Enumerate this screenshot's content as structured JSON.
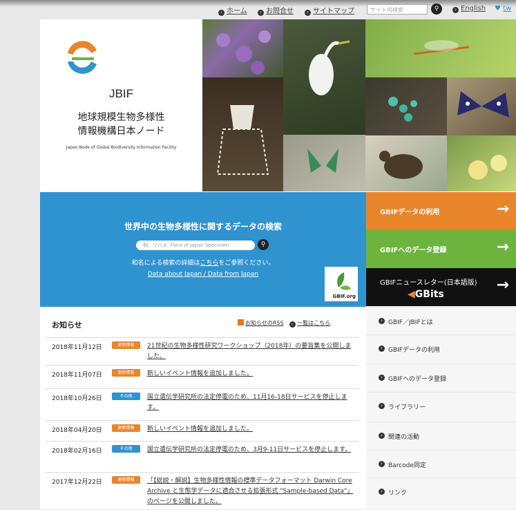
{
  "nav": {
    "home": "ホーム",
    "contact": "お問合せ",
    "sitemap": "サイトマップ",
    "search_placeholder": "サイト内検索",
    "english": "English",
    "twitter": "tw"
  },
  "logo": {
    "abbr": "JBIF",
    "name_line1": "地球規模生物多様性",
    "name_line2": "情報機構日本ノード",
    "english_name": "Japan Node of Global Biodiversity Information Facility"
  },
  "search_panel": {
    "title": "世界中の生物多様性に関するデータの検索",
    "placeholder": "例：ツバメ, Flora of Japan Specimen",
    "note_before": "和名による検索の詳細は",
    "note_link": "こちら",
    "note_after": "をご参照ください。",
    "data_link": "Data about Japan / Data from Japan",
    "gbif_logo_text": "GBIF.org"
  },
  "side_buttons": [
    {
      "label": "GBIFデータの利用",
      "color": "#e9852b"
    },
    {
      "label": "GBIFへのデータ登録",
      "color": "#6db43f"
    },
    {
      "label": "GBIFニュースレター(日本語版)",
      "sub": "GBits",
      "color": "#111111"
    }
  ],
  "news": {
    "heading": "お知らせ",
    "rss": "お知らせのRSS",
    "all": "一覧はこちら",
    "items": [
      {
        "date": "2018年11月12日",
        "badge": "更新情報",
        "badge_color": "#e9852b",
        "text": "21世紀の生物多様性研究ワークショップ（2018年）の要旨集を公開しました。"
      },
      {
        "date": "2018年11月07日",
        "badge": "更新情報",
        "badge_color": "#e9852b",
        "text": "新しいイベント情報を追加しました。"
      },
      {
        "date": "2018年10月26日",
        "badge": "その他",
        "badge_color": "#2f93cf",
        "text": "国立遺伝学研究所の法定停電のため、11月16-18日サービスを停止します。"
      },
      {
        "date": "2018年04月20日",
        "badge": "更新情報",
        "badge_color": "#e9852b",
        "text": "新しいイベント情報を追加しました。"
      },
      {
        "date": "2018年02月16日",
        "badge": "その他",
        "badge_color": "#2f93cf",
        "text": "国立遺伝学研究所の法定停電のため、3月9-11日サービスを停止します。"
      },
      {
        "date": "2017年12月22日",
        "badge": "更新情報",
        "badge_color": "#e9852b",
        "text": "「【総説・解説】生物多様性情報の標準データフォーマット Darwin Core Archive と生態学データに適合させる拡張形式 \"Sample-based Data\"」のページを公開しました。"
      }
    ]
  },
  "right_menu": [
    {
      "label": "GBIF／JBIFとは"
    },
    {
      "label": "GBIFデータの利用"
    },
    {
      "label": "GBIFへのデータ登録"
    },
    {
      "label": "ライブラリー"
    },
    {
      "label": "関連の活動"
    },
    {
      "label": "Barcode同定"
    },
    {
      "label": "リンク"
    }
  ]
}
